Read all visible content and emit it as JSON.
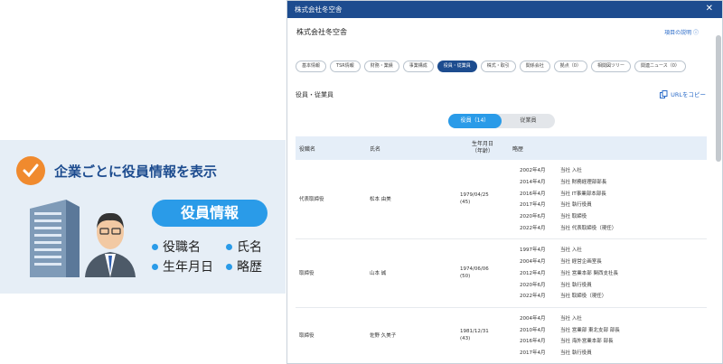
{
  "promo": {
    "title": "企業ごとに役員情報を表示",
    "pill": "役員情報",
    "features": [
      "役職名",
      "氏名",
      "生年月日",
      "略歴"
    ]
  },
  "window": {
    "title": "株式会社冬空舎",
    "company": "株式会社冬空舎",
    "help": "項目の説明 ⓘ",
    "tabs": [
      "基本情報",
      "TSR情報",
      "財務・業績",
      "事業構成",
      "役員・従業員",
      "株式・取引",
      "関係会社",
      "拠点（0）",
      "相関図ツリー",
      "関連ニュース（0）"
    ],
    "section": "役員・従業員",
    "copy": "URLをコピー",
    "segments": [
      "役員（14）",
      "従業員"
    ],
    "headers": {
      "role": "役職名",
      "name": "氏名",
      "birth": "生年月日",
      "age": "（年齢）",
      "career": "略歴"
    },
    "rows": [
      {
        "role": "代表取締役",
        "name": "松本 由美",
        "birth": "1979/04/25",
        "age": "(45)",
        "history": [
          [
            "2002年4月",
            "当社 入社"
          ],
          [
            "2014年4月",
            "当社 財務経理部部長"
          ],
          [
            "2016年4月",
            "当社 IT事業部本部長"
          ],
          [
            "2017年4月",
            "当社 執行役員"
          ],
          [
            "2020年6月",
            "当社 取締役"
          ],
          [
            "2022年4月",
            "当社 代表取締役（現任）"
          ]
        ]
      },
      {
        "role": "取締役",
        "name": "山本 誠",
        "birth": "1974/06/06",
        "age": "(50)",
        "history": [
          [
            "1997年4月",
            "当社 入社"
          ],
          [
            "2004年4月",
            "当社 経営企画室長"
          ],
          [
            "2012年4月",
            "当社 営業本部 関西支社長"
          ],
          [
            "2020年6月",
            "当社 執行役員"
          ],
          [
            "2022年4月",
            "当社 取締役（現任）"
          ]
        ]
      },
      {
        "role": "取締役",
        "name": "佐野 久美子",
        "birth": "1981/12/31",
        "age": "(43)",
        "history": [
          [
            "2004年4月",
            "当社 入社"
          ],
          [
            "2010年4月",
            "当社 営業部 東北支部 部長"
          ],
          [
            "2016年4月",
            "当社 海外営業本部 部長"
          ],
          [
            "2017年4月",
            "当社 執行役員"
          ]
        ]
      }
    ]
  }
}
